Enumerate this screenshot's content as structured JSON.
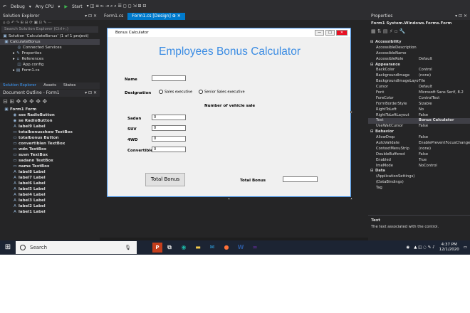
{
  "toolbar": {
    "config": "Debug",
    "platform": "Any CPU",
    "start": "Start"
  },
  "solution_explorer": {
    "title": "Solution Explorer",
    "search_placeholder": "Search Solution Explorer (Ctrl+;)",
    "solution": "Solution 'CalculateBonus' (1 of 1 project)",
    "project": "CalculateBonus",
    "items": [
      "Connected Services",
      "Properties",
      "References",
      "App.config",
      "Form1.cs"
    ],
    "tabs": [
      "Solution Explorer",
      "Assets",
      "States"
    ]
  },
  "document_outline": {
    "title": "Document Outline - Form1",
    "items": [
      "Form1  Form",
      "sse  RadioButton",
      "se  RadioButton",
      "label9  Label",
      "totalbonusshow  TextBox",
      "totalbonus  Button",
      "convertiblen  TextBox",
      "wdn  TextBox",
      "suvn  TextBox",
      "sadann  TextBox",
      "name  TextBox",
      "label8  Label",
      "label7  Label",
      "label6  Label",
      "label5  Label",
      "label4  Label",
      "label3  Label",
      "label2  Label",
      "label1  Label"
    ]
  },
  "editor_tabs": [
    "Form1.cs",
    "Form1.cs [Design]"
  ],
  "form": {
    "window_title": "Bonus Calculator",
    "heading": "Employees Bonus Calculator",
    "name_label": "Name",
    "designation_label": "Designation",
    "radio1": "Sales executive",
    "radio2": "Senior Sales executive",
    "vehicle_heading": "Number of vehicle sale",
    "sadan_label": "Sadan",
    "suv_label": "SUV",
    "wd_label": "4WD",
    "convertible_label": "Convertible",
    "sadan_value": "0",
    "suv_value": "0",
    "wd_value": "0",
    "convertible_value": "0",
    "total_button": "Total Bonus",
    "total_label": "Total Bonus"
  },
  "properties": {
    "title": "Properties",
    "object": "Form1  System.Windows.Forms.Form",
    "rows": [
      {
        "name": "Accessibility",
        "value": "",
        "cat": true
      },
      {
        "name": "AccessibleDescription",
        "value": ""
      },
      {
        "name": "AccessibleName",
        "value": ""
      },
      {
        "name": "AccessibleRole",
        "value": "Default"
      },
      {
        "name": "Appearance",
        "value": "",
        "cat": true
      },
      {
        "name": "BackColor",
        "value": "Control"
      },
      {
        "name": "BackgroundImage",
        "value": "(none)"
      },
      {
        "name": "BackgroundImageLayout",
        "value": "Tile"
      },
      {
        "name": "Cursor",
        "value": "Default"
      },
      {
        "name": "Font",
        "value": "Microsoft Sans Serif, 8.2"
      },
      {
        "name": "ForeColor",
        "value": "ControlText"
      },
      {
        "name": "FormBorderStyle",
        "value": "Sizable"
      },
      {
        "name": "RightToLeft",
        "value": "No"
      },
      {
        "name": "RightToLeftLayout",
        "value": "False"
      },
      {
        "name": "Text",
        "value": "Bonus Calculator"
      },
      {
        "name": "UseWaitCursor",
        "value": "False"
      },
      {
        "name": "Behavior",
        "value": "",
        "cat": true
      },
      {
        "name": "AllowDrop",
        "value": "False"
      },
      {
        "name": "AutoValidate",
        "value": "EnablePreventFocusChange"
      },
      {
        "name": "ContextMenuStrip",
        "value": "(none)"
      },
      {
        "name": "DoubleBuffered",
        "value": "False"
      },
      {
        "name": "Enabled",
        "value": "True"
      },
      {
        "name": "ImeMode",
        "value": "NoControl"
      },
      {
        "name": "Data",
        "value": "",
        "cat": true
      },
      {
        "name": "(ApplicationSettings)",
        "value": ""
      },
      {
        "name": "(DataBindings)",
        "value": ""
      },
      {
        "name": "Tag",
        "value": ""
      }
    ],
    "desc_title": "Text",
    "desc_text": "The text associated with the control."
  },
  "taskbar": {
    "search": "Search",
    "time": "4:37 PM",
    "date": "12/1/2020"
  }
}
